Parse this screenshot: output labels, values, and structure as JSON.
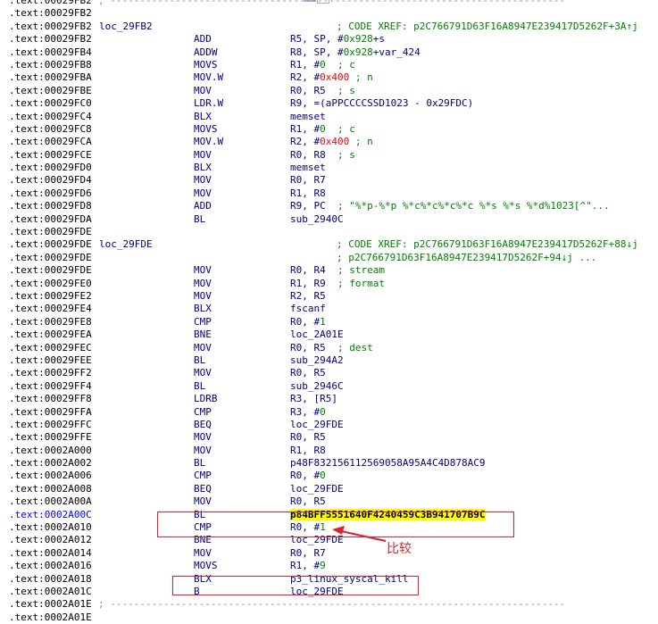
{
  "rows": [
    {
      "kind": "sep",
      "addr": ".text:00029FB2",
      "sep": "; -----------------------------------------------------------------------------"
    },
    {
      "kind": "blank",
      "addr": ".text:00029FB2"
    },
    {
      "kind": "xref",
      "addr": ".text:00029FB2",
      "label": "loc_29FB2",
      "xref": "; CODE XREF: p2C766791D63F16A8947E239417D5262F+3A↑j"
    },
    {
      "kind": "ins",
      "addr": ".text:00029FB2",
      "mn": "ADD",
      "op": [
        {
          "t": "R5, SP, #"
        },
        {
          "t": "0x928",
          "c": "num"
        },
        {
          "t": "+s"
        }
      ]
    },
    {
      "kind": "ins",
      "addr": ".text:00029FB4",
      "mn": "ADDW",
      "op": [
        {
          "t": "R8, SP, #"
        },
        {
          "t": "0x928",
          "c": "num"
        },
        {
          "t": "+var_424"
        }
      ]
    },
    {
      "kind": "ins",
      "addr": ".text:00029FB8",
      "mn": "MOVS",
      "op": [
        {
          "t": "R1, #"
        },
        {
          "t": "0",
          "c": "num"
        },
        {
          "t": "  "
        },
        {
          "t": "; c",
          "c": "cmt"
        }
      ]
    },
    {
      "kind": "ins",
      "addr": ".text:00029FBA",
      "mn": "MOV.W",
      "op": [
        {
          "t": "R2, #"
        },
        {
          "t": "0x400",
          "c": "hex"
        },
        {
          "t": " "
        },
        {
          "t": "; n",
          "c": "cmt"
        }
      ]
    },
    {
      "kind": "ins",
      "addr": ".text:00029FBE",
      "mn": "MOV",
      "op": [
        {
          "t": "R0, R5  "
        },
        {
          "t": "; s",
          "c": "cmt"
        }
      ]
    },
    {
      "kind": "ins",
      "addr": ".text:00029FC0",
      "mn": "LDR.W",
      "op": [
        {
          "t": "R9, =(aPPCCCCSSD1023 - 0x29FDC)"
        }
      ]
    },
    {
      "kind": "ins",
      "addr": ".text:00029FC4",
      "mn": "BLX",
      "op": [
        {
          "t": "memset"
        }
      ]
    },
    {
      "kind": "ins",
      "addr": ".text:00029FC8",
      "mn": "MOVS",
      "op": [
        {
          "t": "R1, #"
        },
        {
          "t": "0",
          "c": "num"
        },
        {
          "t": "  "
        },
        {
          "t": "; c",
          "c": "cmt"
        }
      ]
    },
    {
      "kind": "ins",
      "addr": ".text:00029FCA",
      "mn": "MOV.W",
      "op": [
        {
          "t": "R2, #"
        },
        {
          "t": "0x400",
          "c": "hex"
        },
        {
          "t": " "
        },
        {
          "t": "; n",
          "c": "cmt"
        }
      ]
    },
    {
      "kind": "ins",
      "addr": ".text:00029FCE",
      "mn": "MOV",
      "op": [
        {
          "t": "R0, R8  "
        },
        {
          "t": "; s",
          "c": "cmt"
        }
      ]
    },
    {
      "kind": "ins",
      "addr": ".text:00029FD0",
      "mn": "BLX",
      "op": [
        {
          "t": "memset"
        }
      ]
    },
    {
      "kind": "ins",
      "addr": ".text:00029FD4",
      "mn": "MOV",
      "op": [
        {
          "t": "R0, R7"
        }
      ]
    },
    {
      "kind": "ins",
      "addr": ".text:00029FD6",
      "mn": "MOV",
      "op": [
        {
          "t": "R1, R8"
        }
      ]
    },
    {
      "kind": "ins",
      "addr": ".text:00029FD8",
      "mn": "ADD",
      "op": [
        {
          "t": "R9, PC  "
        },
        {
          "t": "; \"%*p-%*p %*c%*c%*c%*c %*s %*s %*d%1023[^\"...",
          "c": "cmt"
        }
      ]
    },
    {
      "kind": "ins",
      "addr": ".text:00029FDA",
      "mn": "BL",
      "op": [
        {
          "t": "sub_2940C"
        }
      ]
    },
    {
      "kind": "blank",
      "addr": ".text:00029FDE"
    },
    {
      "kind": "xref",
      "addr": ".text:00029FDE",
      "label": "loc_29FDE",
      "xref": "; CODE XREF: p2C766791D63F16A8947E239417D5262F+88↓j"
    },
    {
      "kind": "xref",
      "addr": ".text:00029FDE",
      "label": "",
      "xref": "; p2C766791D63F16A8947E239417D5262F+94↓j ..."
    },
    {
      "kind": "ins",
      "addr": ".text:00029FDE",
      "mn": "MOV",
      "op": [
        {
          "t": "R0, R4  "
        },
        {
          "t": "; stream",
          "c": "cmt"
        }
      ]
    },
    {
      "kind": "ins",
      "addr": ".text:00029FE0",
      "mn": "MOV",
      "op": [
        {
          "t": "R1, R9  "
        },
        {
          "t": "; format",
          "c": "cmt"
        }
      ]
    },
    {
      "kind": "ins",
      "addr": ".text:00029FE2",
      "mn": "MOV",
      "op": [
        {
          "t": "R2, R5"
        }
      ]
    },
    {
      "kind": "ins",
      "addr": ".text:00029FE4",
      "mn": "BLX",
      "op": [
        {
          "t": "fscanf"
        }
      ]
    },
    {
      "kind": "ins",
      "addr": ".text:00029FE8",
      "mn": "CMP",
      "op": [
        {
          "t": "R0, #"
        },
        {
          "t": "1",
          "c": "num"
        }
      ]
    },
    {
      "kind": "ins",
      "addr": ".text:00029FEA",
      "mn": "BNE",
      "op": [
        {
          "t": "loc_2A01E"
        }
      ]
    },
    {
      "kind": "ins",
      "addr": ".text:00029FEC",
      "mn": "MOV",
      "op": [
        {
          "t": "R0, R5  "
        },
        {
          "t": "; dest",
          "c": "cmt"
        }
      ]
    },
    {
      "kind": "ins",
      "addr": ".text:00029FEE",
      "mn": "BL",
      "op": [
        {
          "t": "sub_294A2"
        }
      ]
    },
    {
      "kind": "ins",
      "addr": ".text:00029FF2",
      "mn": "MOV",
      "op": [
        {
          "t": "R0, R5"
        }
      ]
    },
    {
      "kind": "ins",
      "addr": ".text:00029FF4",
      "mn": "BL",
      "op": [
        {
          "t": "sub_2946C"
        }
      ]
    },
    {
      "kind": "ins",
      "addr": ".text:00029FF8",
      "mn": "LDRB",
      "op": [
        {
          "t": "R3, [R5]"
        }
      ]
    },
    {
      "kind": "ins",
      "addr": ".text:00029FFA",
      "mn": "CMP",
      "op": [
        {
          "t": "R3, #"
        },
        {
          "t": "0",
          "c": "num"
        }
      ]
    },
    {
      "kind": "ins",
      "addr": ".text:00029FFC",
      "mn": "BEQ",
      "op": [
        {
          "t": "loc_29FDE"
        }
      ]
    },
    {
      "kind": "ins",
      "addr": ".text:00029FFE",
      "mn": "MOV",
      "op": [
        {
          "t": "R0, R5"
        }
      ]
    },
    {
      "kind": "ins",
      "addr": ".text:0002A000",
      "mn": "MOV",
      "op": [
        {
          "t": "R1, R8"
        }
      ]
    },
    {
      "kind": "ins",
      "addr": ".text:0002A002",
      "mn": "BL",
      "op": [
        {
          "t": "p48F832156112569058A95A4C4D878AC9"
        }
      ]
    },
    {
      "kind": "ins",
      "addr": ".text:0002A006",
      "mn": "CMP",
      "op": [
        {
          "t": "R0, #"
        },
        {
          "t": "0",
          "c": "num"
        }
      ]
    },
    {
      "kind": "ins",
      "addr": ".text:0002A008",
      "mn": "BEQ",
      "op": [
        {
          "t": "loc_29FDE"
        }
      ]
    },
    {
      "kind": "ins",
      "addr": ".text:0002A00A",
      "mn": "MOV",
      "op": [
        {
          "t": "R0, R5"
        }
      ]
    },
    {
      "kind": "ins",
      "addr": ".text:0002A00C",
      "mn": "BL",
      "selected": true,
      "op": [
        {
          "t": "p84BFF5551640F4240459C3B941707B9C",
          "c": "hl"
        }
      ]
    },
    {
      "kind": "ins",
      "addr": ".text:0002A010",
      "mn": "CMP",
      "op": [
        {
          "t": "R0, #"
        },
        {
          "t": "1",
          "c": "num"
        }
      ]
    },
    {
      "kind": "ins",
      "addr": ".text:0002A012",
      "mn": "BNE",
      "op": [
        {
          "t": "loc_29FDE"
        }
      ]
    },
    {
      "kind": "ins",
      "addr": ".text:0002A014",
      "mn": "MOV",
      "op": [
        {
          "t": "R0, R7"
        }
      ]
    },
    {
      "kind": "ins",
      "addr": ".text:0002A016",
      "mn": "MOVS",
      "op": [
        {
          "t": "R1, #"
        },
        {
          "t": "9",
          "c": "num"
        }
      ]
    },
    {
      "kind": "ins",
      "addr": ".text:0002A018",
      "mn": "BLX",
      "op": [
        {
          "t": "p3_linux_syscal_kill"
        }
      ]
    },
    {
      "kind": "ins",
      "addr": ".text:0002A01C",
      "mn": "B",
      "op": [
        {
          "t": "loc_29FDE"
        }
      ]
    },
    {
      "kind": "sep",
      "addr": ".text:0002A01E",
      "sep": "; -----------------------------------------------------------------------------"
    },
    {
      "kind": "blank",
      "addr": ".text:0002A01E"
    }
  ],
  "annotation": {
    "text": "比较",
    "color": "#e0202a"
  },
  "colors": {
    "address": "#000000",
    "selected_address": "#0000ff",
    "mnemonic": "#000080",
    "number": "#008000",
    "hex_immediate": "#ff0000",
    "comment": "#008000",
    "highlight": "#ffff00",
    "separator": "#8c8c8c"
  }
}
